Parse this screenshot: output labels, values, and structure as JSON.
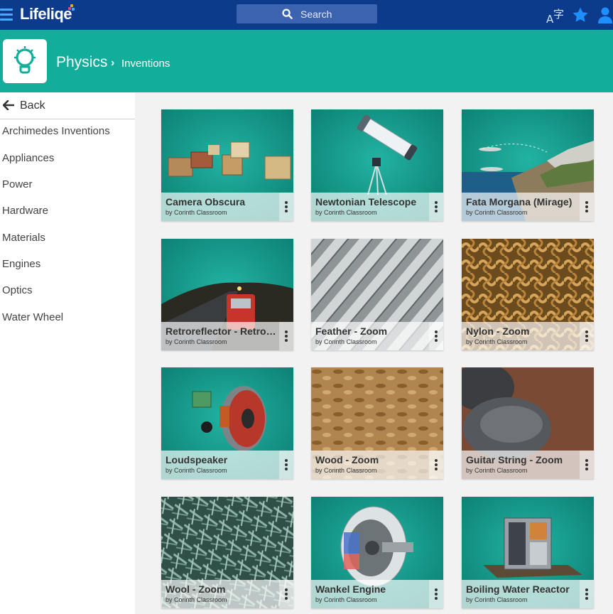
{
  "app": {
    "name": "Lifeliqe"
  },
  "search": {
    "label": "Search"
  },
  "header": {
    "subject": "Physics",
    "separator": "›",
    "current": "Inventions"
  },
  "sidebar": {
    "back_label": "Back",
    "items": [
      {
        "label": "Archimedes Inventions"
      },
      {
        "label": "Appliances"
      },
      {
        "label": "Power"
      },
      {
        "label": "Hardware"
      },
      {
        "label": "Materials"
      },
      {
        "label": "Engines"
      },
      {
        "label": "Optics"
      },
      {
        "label": "Water Wheel"
      }
    ]
  },
  "cards": [
    {
      "title": "Camera Obscura",
      "author": "by Corinth Classroom"
    },
    {
      "title": "Newtonian Telescope",
      "author": "by Corinth Classroom"
    },
    {
      "title": "Fata Morgana (Mirage)",
      "author": "by Corinth Classroom"
    },
    {
      "title": "Retroreflector - Retroreflector",
      "author": "by Corinth Classroom"
    },
    {
      "title": "Feather - Zoom",
      "author": "by Corinth Classroom"
    },
    {
      "title": "Nylon - Zoom",
      "author": "by Corinth Classroom"
    },
    {
      "title": "Loudspeaker",
      "author": "by Corinth Classroom"
    },
    {
      "title": "Wood - Zoom",
      "author": "by Corinth Classroom"
    },
    {
      "title": "Guitar String - Zoom",
      "author": "by Corinth Classroom"
    },
    {
      "title": "Wool - Zoom",
      "author": "by Corinth Classroom"
    },
    {
      "title": "Wankel Engine",
      "author": "by Corinth Classroom"
    },
    {
      "title": "Boiling Water Reactor",
      "author": "by Corinth Classroom"
    }
  ],
  "colors": {
    "topbar": "#0d3b8c",
    "header_teal": "#13ad9b",
    "accent_blue": "#1f8fff",
    "model_teal": "#179e8f"
  },
  "icons": {
    "menu": "hamburger-menu-icon",
    "search": "search-icon",
    "translate": "translate-icon",
    "favorites": "star-icon",
    "account": "user-icon",
    "subject": "lightbulb-icon",
    "back": "back-arrow-icon",
    "card_menu": "more-vertical-icon"
  }
}
